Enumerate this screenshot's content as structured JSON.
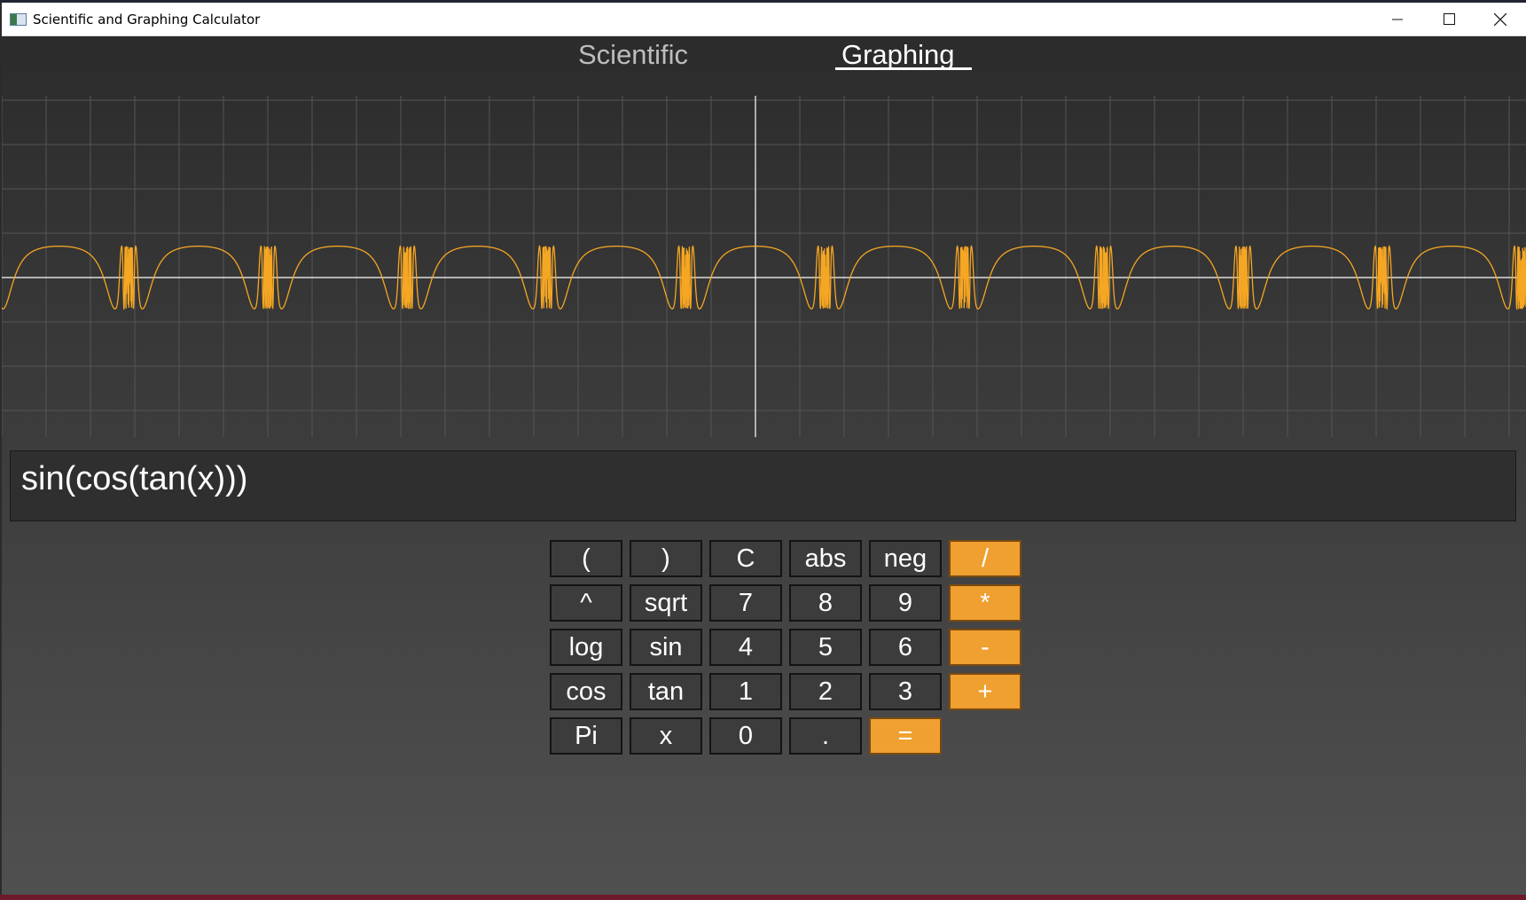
{
  "window": {
    "title": "Scientific and Graphing Calculator",
    "controls": [
      "minimize",
      "maximize",
      "close"
    ]
  },
  "tabs": {
    "scientific": "Scientific",
    "graphing": "Graphing",
    "active": "Graphing"
  },
  "graph": {
    "function": "sin(cos(tan(x)))",
    "curve_color": "#f5a623",
    "axis_color": "#ffffff",
    "grid_color": "#555555"
  },
  "expression": {
    "value": "sin(cos(tan(x)))"
  },
  "keypad": {
    "rows": [
      [
        "(",
        ")",
        "C",
        "abs",
        "neg",
        "/"
      ],
      [
        "^",
        "sqrt",
        "7",
        "8",
        "9",
        "*"
      ],
      [
        "log",
        "sin",
        "4",
        "5",
        "6",
        "-"
      ],
      [
        "cos",
        "tan",
        "1",
        "2",
        "3",
        "+"
      ],
      [
        "Pi",
        "x",
        "0",
        ".",
        "="
      ]
    ],
    "operator_keys": [
      "/",
      "*",
      "-",
      "+",
      "="
    ],
    "operator_color": "#f0a030"
  }
}
